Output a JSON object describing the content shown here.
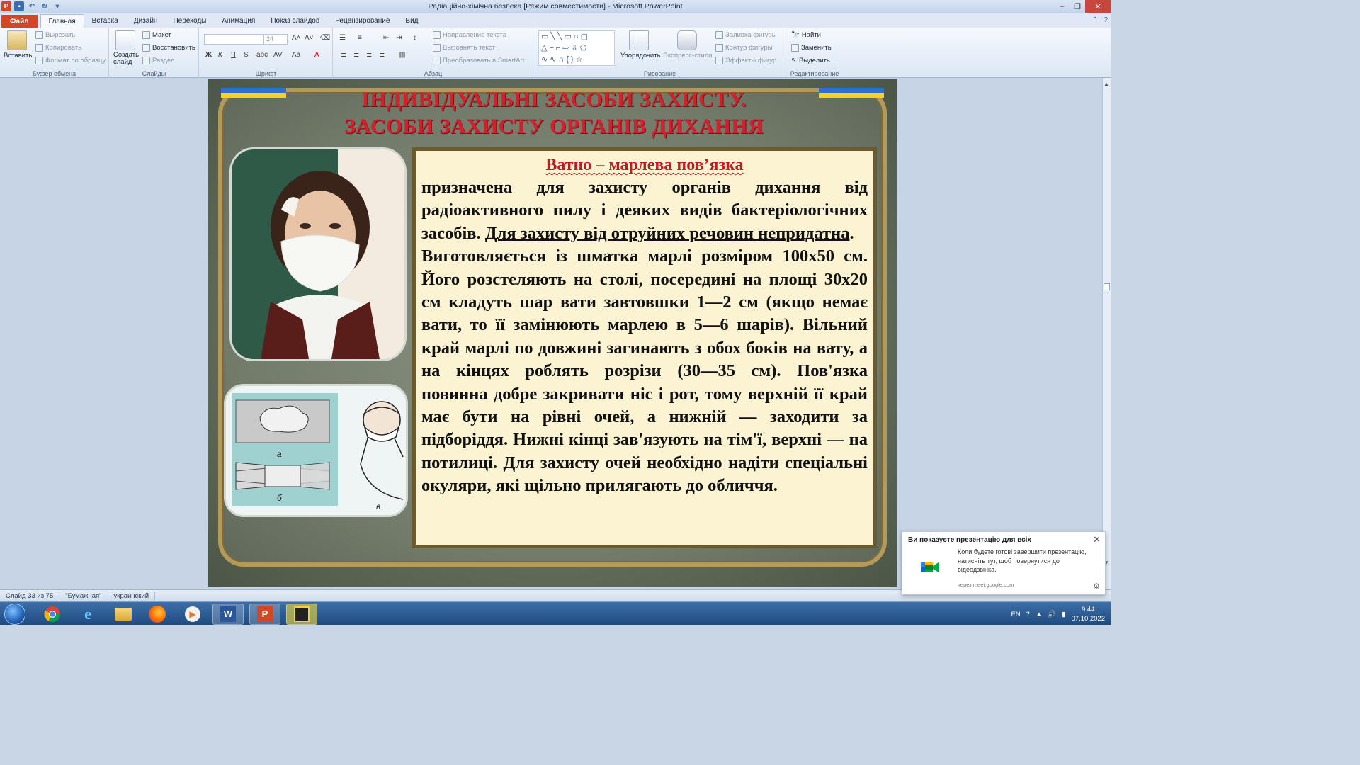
{
  "window": {
    "title": "Радіаційно-хімічна безпека [Режим совместимости] - Microsoft PowerPoint"
  },
  "tabs": [
    "Файл",
    "Главная",
    "Вставка",
    "Дизайн",
    "Переходы",
    "Анимация",
    "Показ слайдов",
    "Рецензирование",
    "Вид"
  ],
  "active_tab": "Главная",
  "ribbon": {
    "clipboard": {
      "label": "Буфер обмена",
      "paste": "Вставить",
      "cut": "Вырезать",
      "copy": "Копировать",
      "format_painter": "Формат по образцу"
    },
    "slides": {
      "label": "Слайды",
      "new_slide": "Создать слайд",
      "layout": "Макет",
      "reset": "Восстановить",
      "section": "Раздел"
    },
    "font": {
      "label": "Шрифт",
      "font_name": "",
      "font_size": "24"
    },
    "paragraph": {
      "label": "Абзац",
      "text_direction": "Направление текста",
      "align_text": "Выровнять текст",
      "smartart": "Преобразовать в SmartArt"
    },
    "drawing": {
      "label": "Рисование",
      "arrange": "Упорядочить",
      "quick_styles": "Экспресс-стили",
      "shape_fill": "Заливка фигуры",
      "shape_outline": "Контур фигуры",
      "shape_effects": "Эффекты фигур"
    },
    "editing": {
      "label": "Редактирование",
      "find": "Найти",
      "replace": "Заменить",
      "select": "Выделить"
    }
  },
  "slide": {
    "title_line1": "ІНДИВІДУАЛЬНІ ЗАСОБИ ЗАХИСТУ.",
    "title_line2": "ЗАСОБИ ЗАХИСТУ ОРГАНІВ ДИХАННЯ",
    "box_heading": "Ватно – марлева пов’язка",
    "para1_a": "призначена для захисту органів дихання від радіоактивного пилу і деяких видів бактеріологічних засобів. ",
    "para1_b": "Для захисту від отруйних речовин непридатна",
    "para1_c": ".",
    "para2": "Виготовляється із шматка марлі розміром 100х50 см. Його розстеляють на столі, посередині на площі 30х20 см кладуть шар вати завтовшки 1—2 см (якщо немає вати, то її замінюють марлею в 5—6 шарів). Вільний край марлі по довжині загинають з обох боків на вату, а на кінцях роблять розрізи (30—35 см). Пов'язка повинна добре закривати ніс і рот, тому верхній її край має бути на рівні очей, а нижній — заходити за підборіддя. Нижні кінці зав'язують на тім'ї, верхні — на потилиці. Для захисту очей необхідно надіти спеціальні окуляри, які щільно прилягають до обличчя.",
    "diagram_labels": [
      "а",
      "б",
      "в"
    ]
  },
  "statusbar": {
    "slide_info": "Слайд 33 из 75",
    "theme": "\"Бумажная\"",
    "language": "украинский"
  },
  "taskbar": {
    "lang": "EN",
    "time": "9:44",
    "date": "07.10.2022"
  },
  "notification": {
    "title": "Ви показуєте презентацію для всіх",
    "body": "Коли будете готові завершити презентацію, натисніть тут, щоб повернутися до відеодзвінка.",
    "source": "через meet.google.com"
  }
}
